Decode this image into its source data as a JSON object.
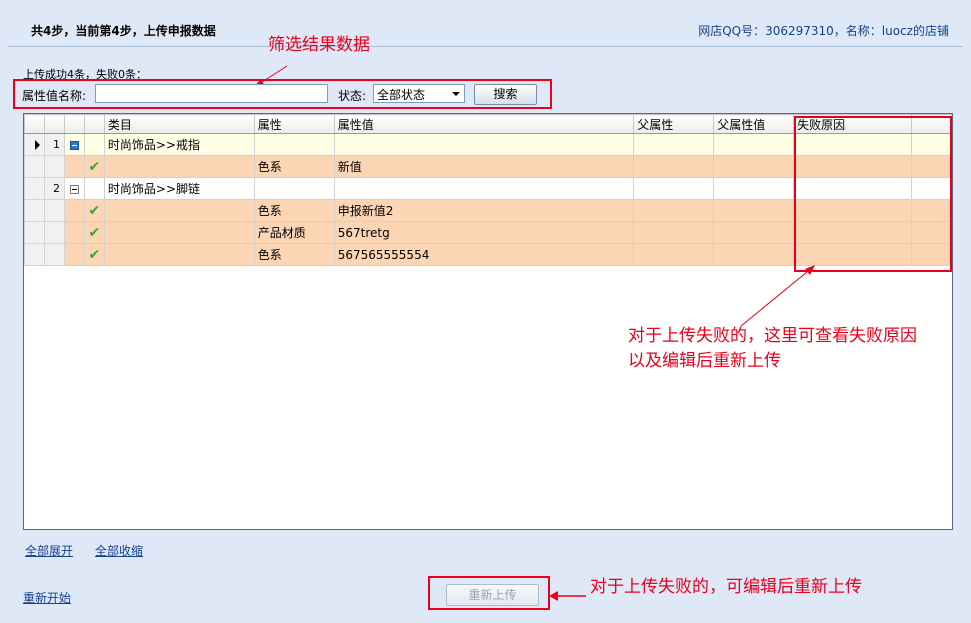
{
  "header": {
    "step_title": "共4步，当前第4步，上传申报数据",
    "shop_info": "网店QQ号：306297310，名称：luocz的店铺"
  },
  "annotations": {
    "filter_note": "筛选结果数据",
    "fail_reason_note_line1": "对于上传失败的，这里可查看失败原因",
    "fail_reason_note_line2": "以及编辑后重新上传",
    "reupload_note": "对于上传失败的，可编辑后重新上传",
    "color": "#e8001c"
  },
  "filter": {
    "result_text": "上传成功4条，失败0条：",
    "attr_label": "属性值名称:",
    "attr_value": "",
    "status_label": "状态:",
    "status_selected": "全部状态",
    "search_label": "搜索"
  },
  "grid": {
    "columns": [
      "类目",
      "属性",
      "属性值",
      "父属性",
      "父属性值",
      "失败原因"
    ],
    "rows": [
      {
        "row_num": "1",
        "type": "parent",
        "selected": true,
        "category": "时尚饰品>>戒指",
        "attr": "",
        "value": "",
        "parent_attr": "",
        "parent_value": "",
        "reason": ""
      },
      {
        "row_num": "",
        "type": "child",
        "status_icon": "check-icon",
        "category": "",
        "attr": "色系",
        "value": "新值",
        "parent_attr": "",
        "parent_value": "",
        "reason": ""
      },
      {
        "row_num": "2",
        "type": "parent",
        "selected": false,
        "category": "时尚饰品>>脚链",
        "attr": "",
        "value": "",
        "parent_attr": "",
        "parent_value": "",
        "reason": ""
      },
      {
        "row_num": "",
        "type": "child",
        "status_icon": "check-icon",
        "category": "",
        "attr": "色系",
        "value": "申报新值2",
        "parent_attr": "",
        "parent_value": "",
        "reason": ""
      },
      {
        "row_num": "",
        "type": "child",
        "status_icon": "check-icon",
        "category": "",
        "attr": "产品材质",
        "value": "567tretg",
        "parent_attr": "",
        "parent_value": "",
        "reason": ""
      },
      {
        "row_num": "",
        "type": "child",
        "status_icon": "check-icon",
        "category": "",
        "attr": "色系",
        "value": "567565555554",
        "parent_attr": "",
        "parent_value": "",
        "reason": ""
      }
    ]
  },
  "links": {
    "expand_all": "全部展开",
    "collapse_all": "全部收缩",
    "restart": "重新开始"
  },
  "reupload_button": "重新上传"
}
